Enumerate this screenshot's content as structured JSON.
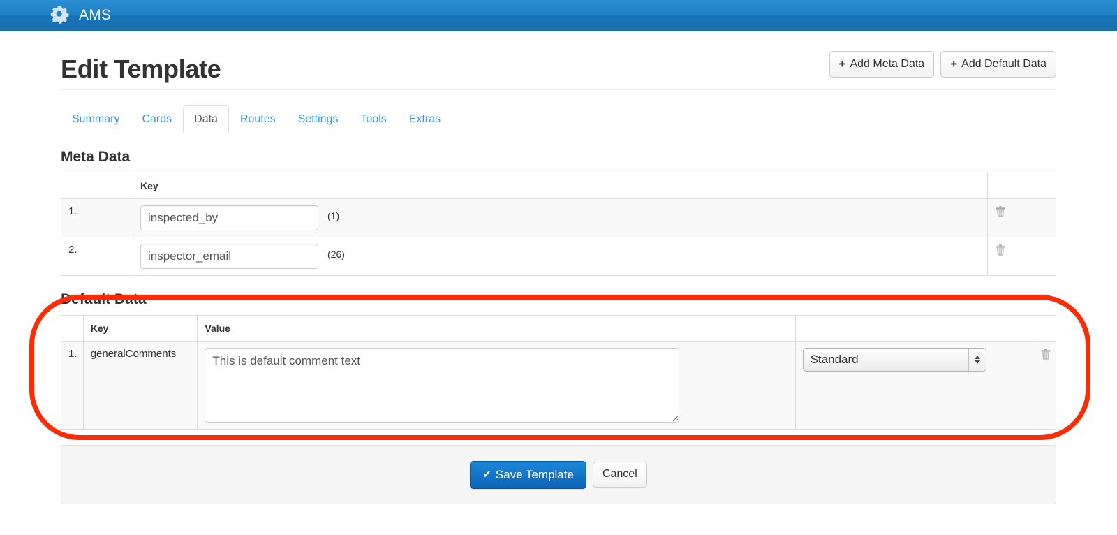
{
  "navbar": {
    "brand_icon": "gear-icon",
    "brand": "AMS",
    "bg_color": "#1e7fc4"
  },
  "header": {
    "title": "Edit Template",
    "actions": [
      {
        "icon": "plus-icon",
        "plus": "+",
        "label": "Add Meta Data"
      },
      {
        "icon": "plus-icon",
        "plus": "+",
        "label": "Add Default Data"
      }
    ]
  },
  "tabs": [
    {
      "label": "Summary",
      "active": false
    },
    {
      "label": "Cards",
      "active": false
    },
    {
      "label": "Data",
      "active": true
    },
    {
      "label": "Routes",
      "active": false
    },
    {
      "label": "Settings",
      "active": false
    },
    {
      "label": "Tools",
      "active": false
    },
    {
      "label": "Extras",
      "active": false
    }
  ],
  "meta_data": {
    "section_title": "Meta Data",
    "columns": [
      "",
      "Key",
      ""
    ],
    "rows": [
      {
        "index": "1.",
        "key_value": "inspected_by",
        "key_placeholder": "Key",
        "length_note": "(1)",
        "delete_icon": "trash-icon"
      },
      {
        "index": "2.",
        "key_value": "inspector_email",
        "key_placeholder": "Key",
        "length_note": "(26)",
        "delete_icon": "trash-icon"
      }
    ]
  },
  "default_data": {
    "section_title": "Default Data",
    "columns": [
      "",
      "Key",
      "Value",
      "",
      ""
    ],
    "rows": [
      {
        "index": "1.",
        "key": "generalComments",
        "value": "This is default comment text",
        "value_placeholder": "Value",
        "type_selected": "Standard",
        "type_options": [
          "Standard"
        ],
        "delete_icon": "trash-icon"
      }
    ]
  },
  "footer": {
    "save_check": "✔",
    "save_label": "Save Template",
    "cancel_label": "Cancel"
  },
  "annotation": {
    "shape": "red-oval-highlight",
    "color": "#fb2c06",
    "targets": "Default Data"
  }
}
